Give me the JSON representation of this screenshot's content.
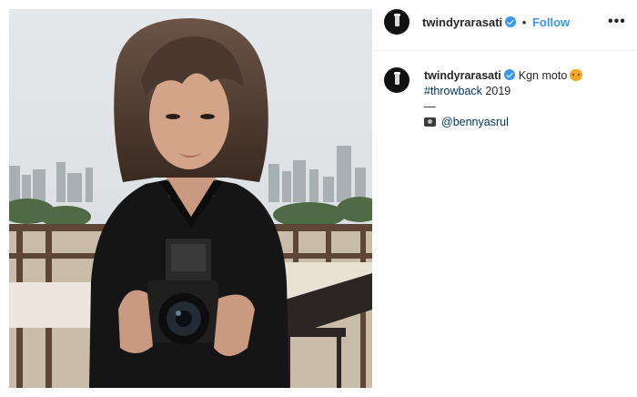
{
  "post": {
    "username": "twindyrarasati",
    "separator": "•",
    "follow_label": "Follow",
    "more_label": "•••"
  },
  "caption": {
    "username": "twindyrarasati",
    "text": "Kgn moto",
    "hashtag": "#throwback",
    "hashtag_suffix": " 2019",
    "divider": "—",
    "mention": "@bennyasrul"
  },
  "icons": {
    "verified": "verified-badge-icon",
    "cat_emoji": "grinning-cat-emoji-icon",
    "camera_emoji": "camera-emoji-icon",
    "more": "more-options-icon"
  },
  "colors": {
    "link": "#3897f0",
    "hashtag": "#003569",
    "text": "#262626",
    "verified": "#3897f0"
  }
}
